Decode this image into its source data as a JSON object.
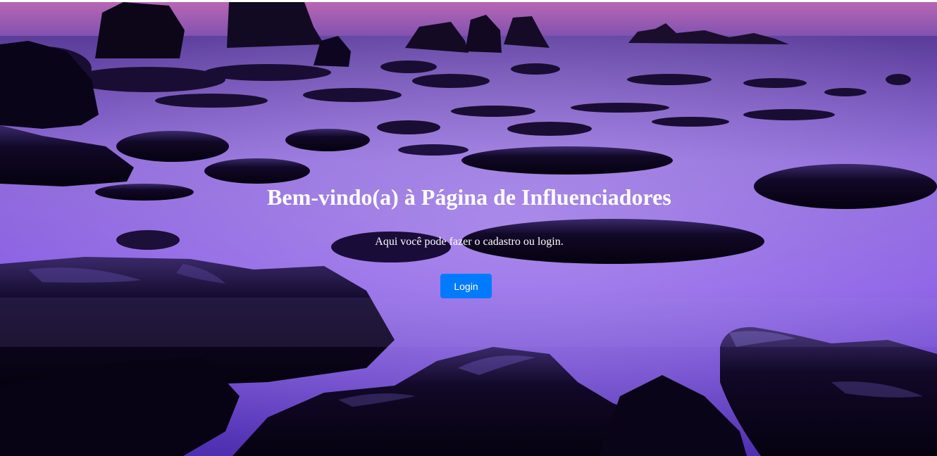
{
  "hero": {
    "title": "Bem-vindo(a) à Página de Influenciadores",
    "subtitle": "Aqui você pode fazer o cadastro ou login.",
    "background_description": "purple misty seascape with dark rocks"
  },
  "actions": {
    "login_label": "Login"
  },
  "colors": {
    "button": "#007bff",
    "text": "#ffffff",
    "sky_top": "#b060b0",
    "mist": "#8a66e0",
    "rock": "#0d0620"
  }
}
